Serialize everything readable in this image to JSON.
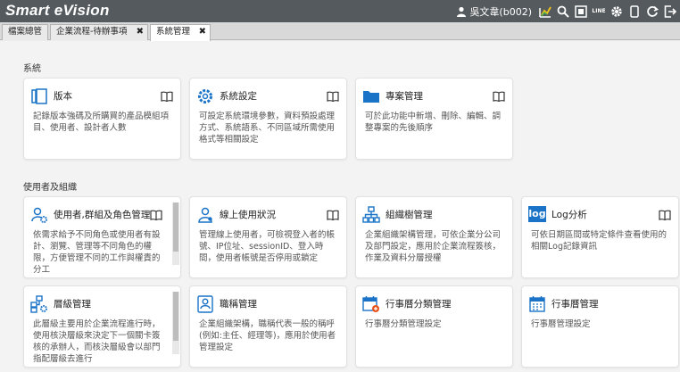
{
  "app": {
    "title": "Smart eVision"
  },
  "header": {
    "user_name": "吳文韋(b002)",
    "line_label": "LINE"
  },
  "tabs": [
    {
      "label": "檔案總管",
      "closable": false,
      "active": false
    },
    {
      "label": "企業流程-待辦事項",
      "closable": true,
      "active": false
    },
    {
      "label": "系統管理",
      "closable": true,
      "active": true
    }
  ],
  "sections": [
    {
      "title": "系統",
      "cards": [
        {
          "icon": "version-icon",
          "title": "版本",
          "desc": "記錄版本強碼及所購買的產品模組項目、使用者、設計者人數",
          "help": true
        },
        {
          "icon": "gear-icon",
          "title": "系統設定",
          "desc": "可設定系統環境參數，資料預設處理方式、系統語系、不同區域所需使用格式等相關設定",
          "help": true
        },
        {
          "icon": "folder-icon",
          "title": "專案管理",
          "desc": "可於此功能中新增、刪除、編輯、調整專案的先後順序",
          "help": true
        }
      ]
    },
    {
      "title": "使用者及組織",
      "cards": [
        {
          "icon": "user-gear-icon",
          "title": "使用者,群組及角色管理",
          "desc": "依需求給予不同角色或使用者有設計、瀏覽、管理等不同角色的權限，方便管理不同的工作與權責的分工",
          "help": true,
          "scroll": true
        },
        {
          "icon": "online-user-icon",
          "title": "線上使用狀況",
          "desc": "管理線上使用者，可檢視登入者的帳號、IP位址、sessionID、登入時間，使用者帳號是否停用或鎖定",
          "help": true
        },
        {
          "icon": "org-tree-icon",
          "title": "組織樹管理",
          "desc": "企業組織架構管理，可依企業分公司及部門設定，應用於企業流程簽核，作業及資料分層授權",
          "help": false
        },
        {
          "icon": "log-icon",
          "log_text": "log",
          "title": "Log分析",
          "desc": "可依日期區間或特定條件查看使用的相關Log記錄資訊",
          "help": true
        },
        {
          "icon": "level-icon",
          "title": "層級管理",
          "desc": "此層級主要用於企業流程進行時，使用核決層級來決定下一個關卡簽核的承辦人，而核決層級會以部門指配層級去進行",
          "help": false,
          "scroll": true
        },
        {
          "icon": "job-title-icon",
          "title": "職稱管理",
          "desc": "企業組織架構，職稱代表一般的稱呼(例如:主任、經理等)，應用於使用者管理設定",
          "help": false
        },
        {
          "icon": "calendar-category-icon",
          "title": "行事曆分類管理",
          "desc": "行事曆分類管理設定",
          "help": false
        },
        {
          "icon": "calendar-icon",
          "title": "行事曆管理",
          "desc": "行事曆管理設定",
          "help": false
        }
      ]
    }
  ],
  "colors": {
    "topbar": "#555a5e",
    "accent": "#1a73c7",
    "background": "#f3f3f3"
  }
}
